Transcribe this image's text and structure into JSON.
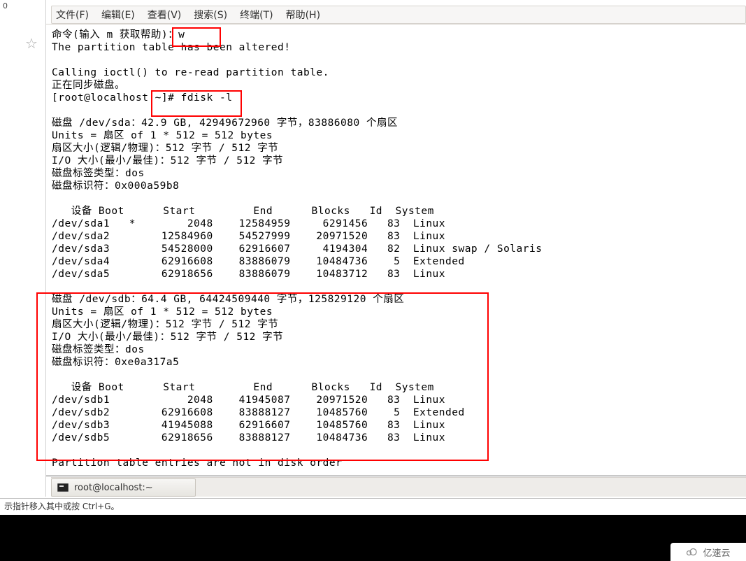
{
  "gutter": {
    "num": "0"
  },
  "menu": {
    "file": "文件(F)",
    "edit": "编辑(E)",
    "view": "查看(V)",
    "search": "搜索(S)",
    "terminal": "终端(T)",
    "help": "帮助(H)"
  },
  "terminal_text": "命令(输入 m 获取帮助)：w\nThe partition table has been altered!\n\nCalling ioctl() to re-read partition table.\n正在同步磁盘。\n[root@localhost ~]# fdisk -l\n\n磁盘 /dev/sda：42.9 GB, 42949672960 字节，83886080 个扇区\nUnits = 扇区 of 1 * 512 = 512 bytes\n扇区大小(逻辑/物理)：512 字节 / 512 字节\nI/O 大小(最小/最佳)：512 字节 / 512 字节\n磁盘标签类型：dos\n磁盘标识符：0x000a59b8\n\n   设备 Boot      Start         End      Blocks   Id  System\n/dev/sda1   *        2048    12584959     6291456   83  Linux\n/dev/sda2        12584960    54527999    20971520   83  Linux\n/dev/sda3        54528000    62916607     4194304   82  Linux swap / Solaris\n/dev/sda4        62916608    83886079    10484736    5  Extended\n/dev/sda5        62918656    83886079    10483712   83  Linux\n\n磁盘 /dev/sdb：64.4 GB, 64424509440 字节，125829120 个扇区\nUnits = 扇区 of 1 * 512 = 512 bytes\n扇区大小(逻辑/物理)：512 字节 / 512 字节\nI/O 大小(最小/最佳)：512 字节 / 512 字节\n磁盘标签类型：dos\n磁盘标识符：0xe0a317a5\n\n   设备 Boot      Start         End      Blocks   Id  System\n/dev/sdb1            2048    41945087    20971520   83  Linux\n/dev/sdb2        62916608    83888127    10485760    5  Extended\n/dev/sdb3        41945088    62916607    10485760   83  Linux\n/dev/sdb5        62918656    83888127    10484736   83  Linux\n\nPartition table entries are not in disk order",
  "tab": {
    "title": "root@localhost:~"
  },
  "status": {
    "hint": "示指针移入其中或按 Ctrl+G。"
  },
  "watermark": {
    "text": "亿速云"
  },
  "disks": {
    "sda": {
      "size_human": "42.9 GB",
      "bytes": 42949672960,
      "sectors": 83886080,
      "unit_bytes": 512,
      "sector_logical": 512,
      "sector_physical": 512,
      "io_min": 512,
      "io_opt": 512,
      "label_type": "dos",
      "identifier": "0x000a59b8",
      "partitions": [
        {
          "device": "/dev/sda1",
          "boot": "*",
          "start": 2048,
          "end": 12584959,
          "blocks": 6291456,
          "id": "83",
          "system": "Linux"
        },
        {
          "device": "/dev/sda2",
          "boot": "",
          "start": 12584960,
          "end": 54527999,
          "blocks": 20971520,
          "id": "83",
          "system": "Linux"
        },
        {
          "device": "/dev/sda3",
          "boot": "",
          "start": 54528000,
          "end": 62916607,
          "blocks": 4194304,
          "id": "82",
          "system": "Linux swap / Solaris"
        },
        {
          "device": "/dev/sda4",
          "boot": "",
          "start": 62916608,
          "end": 83886079,
          "blocks": 10484736,
          "id": "5",
          "system": "Extended"
        },
        {
          "device": "/dev/sda5",
          "boot": "",
          "start": 62918656,
          "end": 83886079,
          "blocks": 10483712,
          "id": "83",
          "system": "Linux"
        }
      ]
    },
    "sdb": {
      "size_human": "64.4 GB",
      "bytes": 64424509440,
      "sectors": 125829120,
      "unit_bytes": 512,
      "sector_logical": 512,
      "sector_physical": 512,
      "io_min": 512,
      "io_opt": 512,
      "label_type": "dos",
      "identifier": "0xe0a317a5",
      "partitions": [
        {
          "device": "/dev/sdb1",
          "boot": "",
          "start": 2048,
          "end": 41945087,
          "blocks": 20971520,
          "id": "83",
          "system": "Linux"
        },
        {
          "device": "/dev/sdb2",
          "boot": "",
          "start": 62916608,
          "end": 83888127,
          "blocks": 10485760,
          "id": "5",
          "system": "Extended"
        },
        {
          "device": "/dev/sdb3",
          "boot": "",
          "start": 41945088,
          "end": 62916607,
          "blocks": 10485760,
          "id": "83",
          "system": "Linux"
        },
        {
          "device": "/dev/sdb5",
          "boot": "",
          "start": 62918656,
          "end": 83888127,
          "blocks": 10484736,
          "id": "83",
          "system": "Linux"
        }
      ]
    }
  },
  "commands": {
    "prompt": "[root@localhost ~]#",
    "input_line": "命令(输入 m 获取帮助)：",
    "entered": "w",
    "fdisk": "fdisk -l"
  },
  "highlight_colors": {
    "red": "#ff0000"
  }
}
